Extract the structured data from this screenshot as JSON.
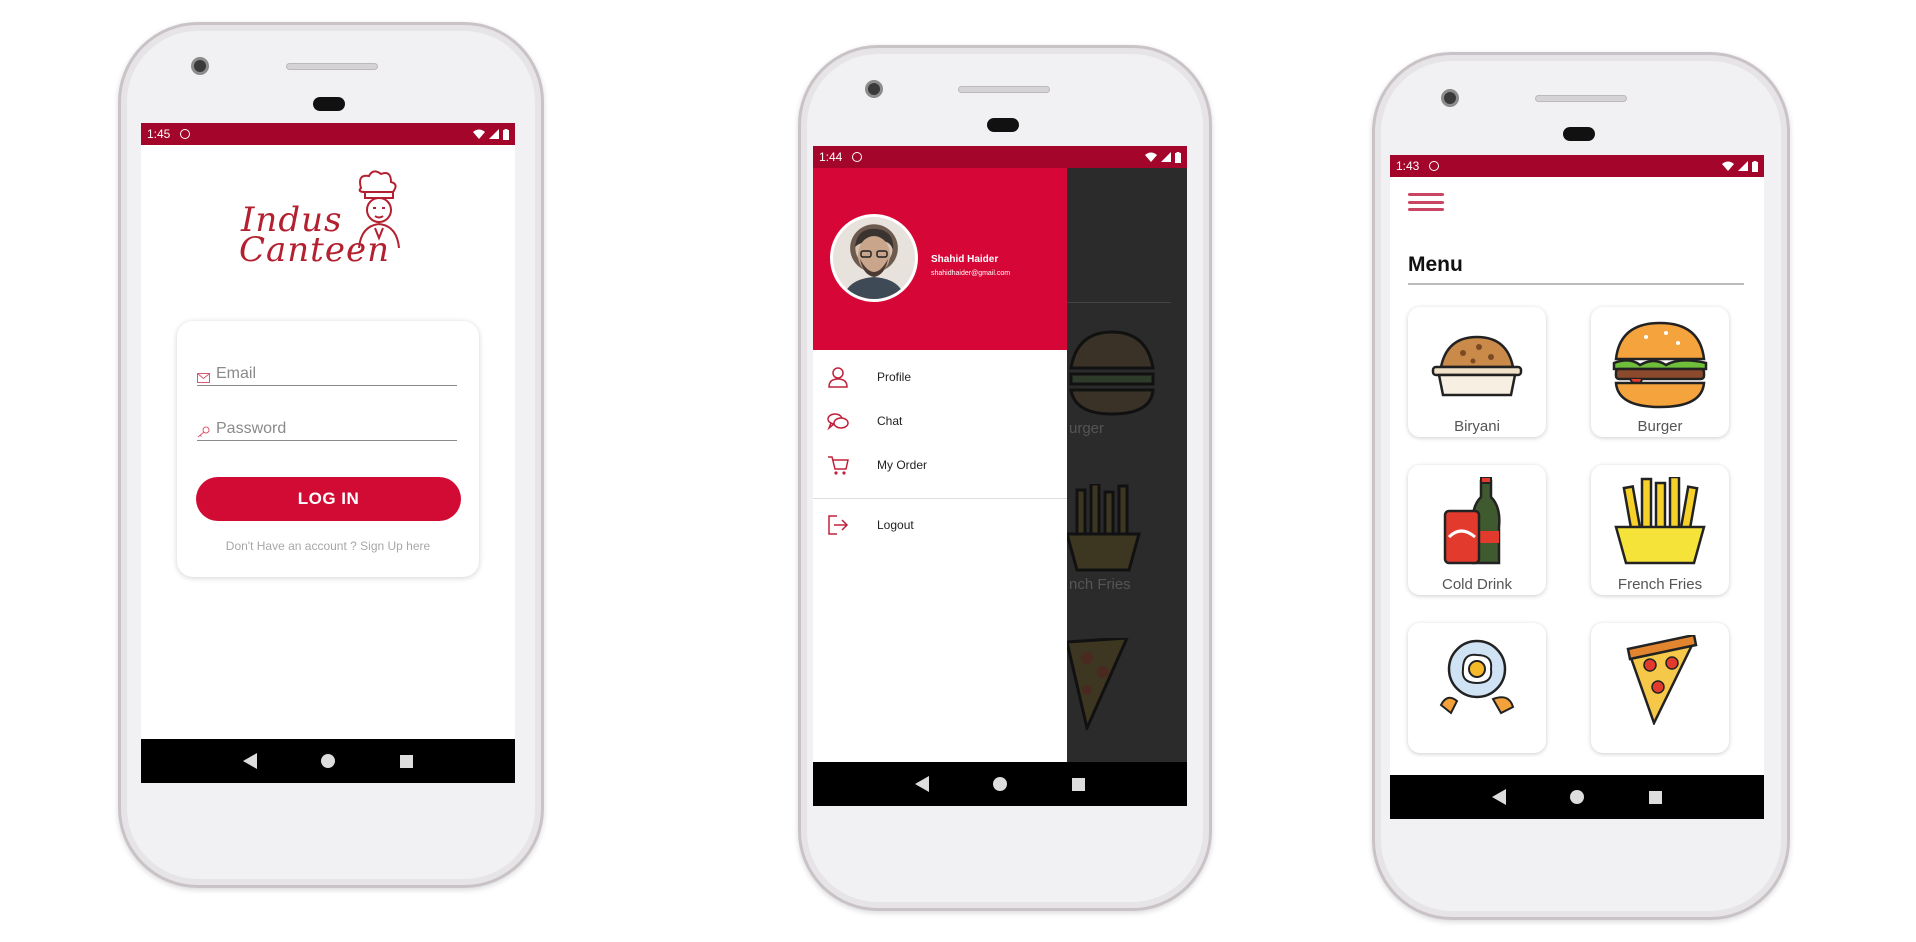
{
  "phones": [
    {
      "screen": "login",
      "status": {
        "time": "1:45"
      },
      "logo": {
        "line1": "Indus",
        "line2": "Canteen"
      },
      "email": {
        "placeholder": "Email"
      },
      "password": {
        "placeholder": "Password"
      },
      "login_button": "LOG IN",
      "signup_text": "Don't Have an account ? Sign Up here"
    },
    {
      "screen": "drawer",
      "status": {
        "time": "1:44"
      },
      "user": {
        "name": "Shahid Haider",
        "email": "shahidhaider@gmail.com"
      },
      "menu_items": [
        {
          "label": "Profile",
          "icon": "user-icon"
        },
        {
          "label": "Chat",
          "icon": "chat-icon"
        },
        {
          "label": "My Order",
          "icon": "cart-icon"
        },
        {
          "label": "Logout",
          "icon": "logout-icon"
        }
      ],
      "background_labels": [
        "urger",
        "nch Fries"
      ]
    },
    {
      "screen": "menu",
      "status": {
        "time": "1:43"
      },
      "title": "Menu",
      "items": [
        {
          "label": "Biryani",
          "icon": "biryani-icon"
        },
        {
          "label": "Burger",
          "icon": "burger-icon"
        },
        {
          "label": "Cold Drink",
          "icon": "cold-drink-icon"
        },
        {
          "label": "French Fries",
          "icon": "french-fries-icon"
        },
        {
          "label": "",
          "icon": "egg-icon"
        },
        {
          "label": "",
          "icon": "pizza-icon"
        }
      ]
    }
  ],
  "colors": {
    "status_bar": "#a4052a",
    "accent": "#d10b34",
    "drawer_header": "#d60636"
  }
}
